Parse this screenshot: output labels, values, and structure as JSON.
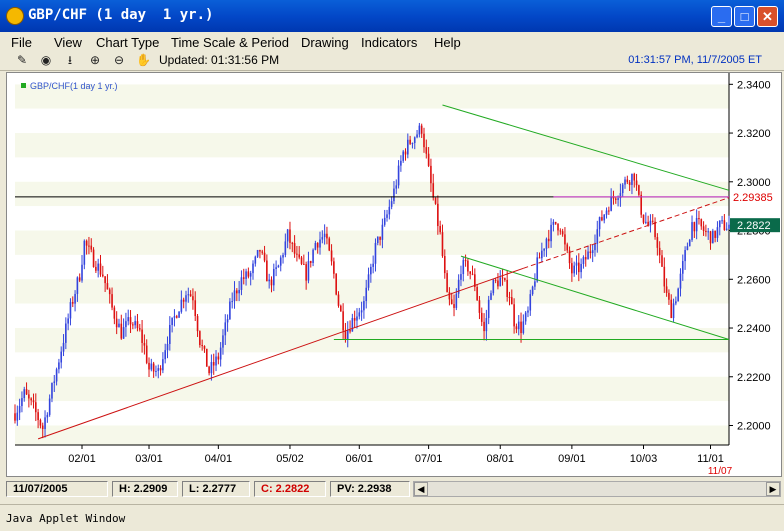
{
  "window": {
    "title": "GBP/CHF (1 day  1 yr.)",
    "min": "_",
    "max": "□",
    "close": "✕"
  },
  "menu": [
    "File",
    "View",
    "Chart Type",
    "Time Scale & Period",
    "Drawing",
    "Indicators",
    "Help"
  ],
  "toolbar": {
    "updated": "Updated: 01:31:56 PM",
    "clock": "01:31:57 PM, 11/7/2005 ET",
    "icons": [
      "pencil-icon",
      "pointer-icon",
      "crosshair-icon",
      "zoom-in-icon",
      "zoom-out-icon",
      "hand-icon"
    ]
  },
  "status": {
    "date": "11/07/2005",
    "high": "H: 2.2909",
    "low": "L: 2.2777",
    "close": "C: 2.2822",
    "pv": "PV: 2.2938"
  },
  "footer": "Java Applet Window",
  "colors": {
    "up": "#3344dd",
    "down": "#dd1111",
    "green": "#22aa22",
    "red": "#cc1111",
    "magenta": "#dd33dd",
    "pv": "#dd0000",
    "price": "#0a6a4a"
  },
  "chart_data": {
    "type": "candlestick",
    "legend": "GBP/CHF(1 day  1 yr.)",
    "ylim": [
      2.192,
      2.343
    ],
    "y_ticks": [
      "2.3400",
      "2.3200",
      "2.3000",
      "2.2800",
      "2.2600",
      "2.2400",
      "2.2200",
      "2.2000"
    ],
    "y_tick_values": [
      2.34,
      2.32,
      2.3,
      2.28,
      2.26,
      2.24,
      2.22,
      2.2
    ],
    "x_ticks": [
      "02/01",
      "03/01",
      "04/01",
      "05/02",
      "06/01",
      "07/01",
      "08/01",
      "09/01",
      "10/03",
      "11/01"
    ],
    "x_tick_days": [
      29,
      58,
      88,
      119,
      149,
      179,
      210,
      241,
      272,
      301
    ],
    "last_x_label": "11/07",
    "n_days": 309,
    "close_path": [
      [
        0,
        2.205
      ],
      [
        4,
        2.213
      ],
      [
        8,
        2.207
      ],
      [
        12,
        2.199
      ],
      [
        18,
        2.223
      ],
      [
        24,
        2.248
      ],
      [
        28,
        2.262
      ],
      [
        30,
        2.275
      ],
      [
        34,
        2.268
      ],
      [
        38,
        2.262
      ],
      [
        42,
        2.248
      ],
      [
        46,
        2.238
      ],
      [
        50,
        2.243
      ],
      [
        54,
        2.238
      ],
      [
        56,
        2.232
      ],
      [
        58,
        2.223
      ],
      [
        62,
        2.222
      ],
      [
        66,
        2.236
      ],
      [
        70,
        2.247
      ],
      [
        74,
        2.255
      ],
      [
        77,
        2.253
      ],
      [
        80,
        2.235
      ],
      [
        84,
        2.222
      ],
      [
        88,
        2.228
      ],
      [
        94,
        2.252
      ],
      [
        98,
        2.26
      ],
      [
        102,
        2.262
      ],
      [
        106,
        2.272
      ],
      [
        110,
        2.258
      ],
      [
        114,
        2.265
      ],
      [
        118,
        2.278
      ],
      [
        122,
        2.268
      ],
      [
        126,
        2.262
      ],
      [
        130,
        2.275
      ],
      [
        134,
        2.278
      ],
      [
        138,
        2.262
      ],
      [
        140,
        2.25
      ],
      [
        143,
        2.238
      ],
      [
        147,
        2.245
      ],
      [
        151,
        2.25
      ],
      [
        156,
        2.273
      ],
      [
        160,
        2.283
      ],
      [
        164,
        2.296
      ],
      [
        168,
        2.312
      ],
      [
        172,
        2.318
      ],
      [
        176,
        2.322
      ],
      [
        178,
        2.31
      ],
      [
        181,
        2.293
      ],
      [
        184,
        2.278
      ],
      [
        187,
        2.252
      ],
      [
        190,
        2.247
      ],
      [
        193,
        2.265
      ],
      [
        196,
        2.265
      ],
      [
        199,
        2.258
      ],
      [
        201,
        2.247
      ],
      [
        203,
        2.238
      ],
      [
        206,
        2.257
      ],
      [
        210,
        2.26
      ],
      [
        214,
        2.254
      ],
      [
        216,
        2.243
      ],
      [
        219,
        2.24
      ],
      [
        222,
        2.246
      ],
      [
        226,
        2.266
      ],
      [
        230,
        2.277
      ],
      [
        234,
        2.283
      ],
      [
        236,
        2.282
      ],
      [
        238,
        2.273
      ],
      [
        241,
        2.263
      ],
      [
        245,
        2.265
      ],
      [
        249,
        2.272
      ],
      [
        253,
        2.283
      ],
      [
        257,
        2.291
      ],
      [
        261,
        2.296
      ],
      [
        265,
        2.301
      ],
      [
        268,
        2.303
      ],
      [
        270,
        2.292
      ],
      [
        272,
        2.285
      ],
      [
        274,
        2.282
      ],
      [
        276,
        2.281
      ],
      [
        278,
        2.275
      ],
      [
        280,
        2.263
      ],
      [
        282,
        2.253
      ],
      [
        284,
        2.247
      ],
      [
        287,
        2.256
      ],
      [
        290,
        2.27
      ],
      [
        293,
        2.283
      ],
      [
        296,
        2.282
      ],
      [
        299,
        2.279
      ],
      [
        302,
        2.277
      ],
      [
        305,
        2.282
      ],
      [
        309,
        2.282
      ]
    ],
    "lines": [
      {
        "name": "resistance",
        "color": "green",
        "from": [
          185,
          2.3315
        ],
        "to": [
          309,
          2.2965
        ]
      },
      {
        "name": "support",
        "color": "green",
        "from": [
          138,
          2.2353
        ],
        "to": [
          309,
          2.2353
        ]
      },
      {
        "name": "lower-channel",
        "color": "green",
        "from": [
          193,
          2.2695
        ],
        "to": [
          309,
          2.2353
        ]
      },
      {
        "name": "uptrend",
        "color": "red",
        "from": [
          10,
          2.1945
        ],
        "to": [
          220,
          2.2645
        ]
      },
      {
        "name": "uptrend-ext",
        "color": "red",
        "dashed": true,
        "from": [
          220,
          2.2645
        ],
        "to": [
          309,
          2.2935
        ]
      },
      {
        "name": "black-level",
        "color": "black",
        "from": [
          0,
          2.2938
        ],
        "to": [
          309,
          2.2938
        ]
      },
      {
        "name": "pv-level",
        "color": "magenta",
        "from": [
          233,
          2.2938
        ],
        "to": [
          309,
          2.2938
        ]
      }
    ],
    "price_label": "2.2822",
    "price_value": 2.2822,
    "pv_label": "2.29385",
    "pv_value": 2.29385
  }
}
